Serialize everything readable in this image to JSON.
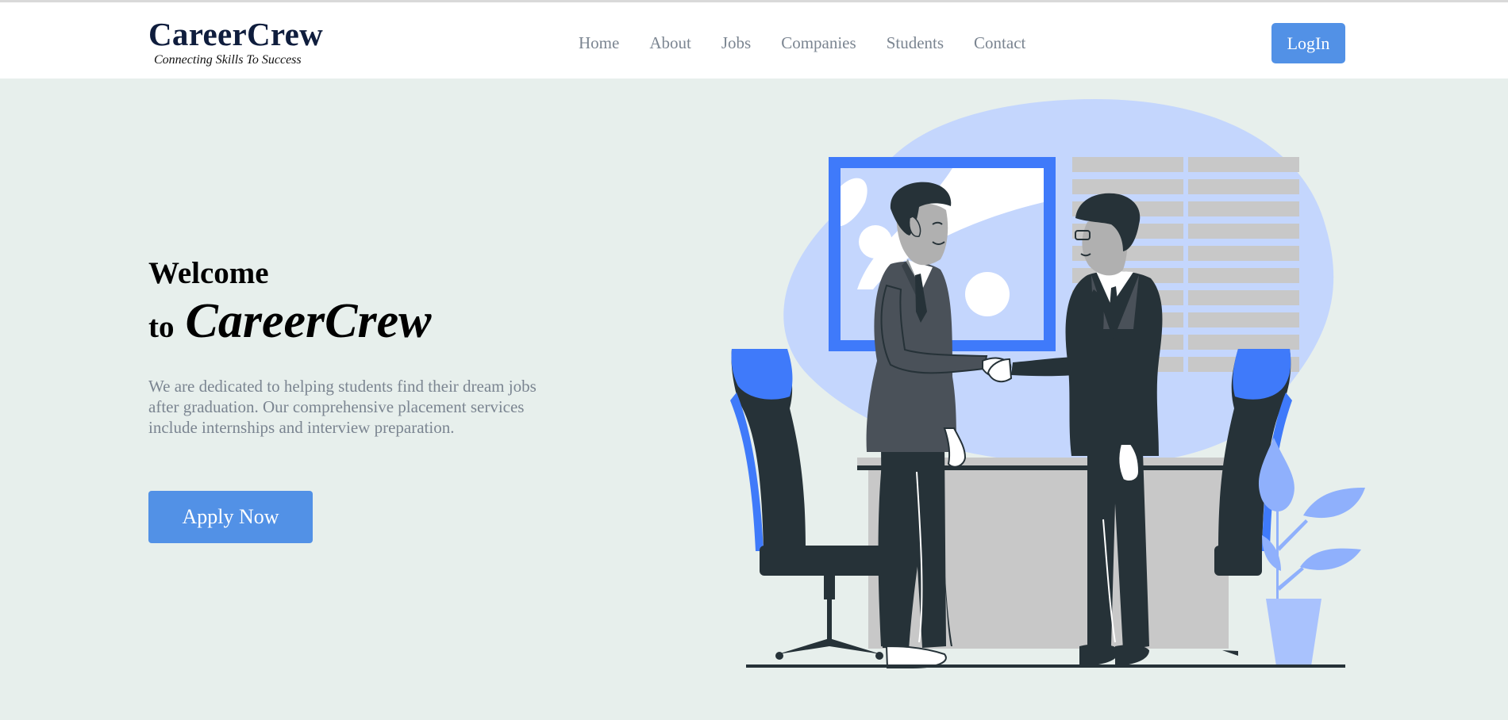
{
  "header": {
    "brand_name": "CareerCrew",
    "brand_tagline": "Connecting Skills To Success",
    "nav": [
      {
        "label": "Home"
      },
      {
        "label": "About"
      },
      {
        "label": "Jobs"
      },
      {
        "label": "Companies"
      },
      {
        "label": "Students"
      },
      {
        "label": "Contact"
      }
    ],
    "login_label": "LogIn"
  },
  "hero": {
    "welcome": "Welcome",
    "to": "to",
    "brand": "CareerCrew",
    "description": "We are dedicated to helping students find their dream jobs after graduation. Our comprehensive placement services include internships and interview preparation.",
    "apply_label": "Apply Now"
  },
  "colors": {
    "background": "#e7efec",
    "accent": "#5291e6",
    "brand_text": "#0f1d3d",
    "nav_text": "#7b8591",
    "illustration_blue": "#3f7afa",
    "illustration_light_blue": "#c4d6fd",
    "illustration_dark": "#263238"
  },
  "icons": {
    "illustration": "business-handshake-illustration"
  }
}
